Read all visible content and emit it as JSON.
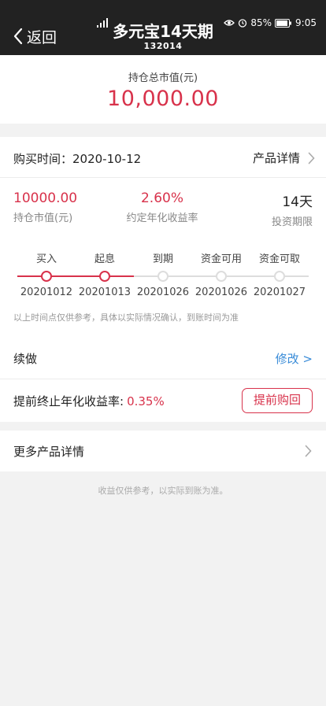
{
  "header": {
    "back_label": "返回",
    "title": "多元宝14天期",
    "code": "132014",
    "status": {
      "battery": "85%",
      "time": "9:05"
    }
  },
  "summary": {
    "label": "持仓总市值(元)",
    "value": "10,000.00"
  },
  "purchase": {
    "label": "购买时间：2020-10-12",
    "detail_link": "产品详情"
  },
  "stats": [
    {
      "value": "10000.00",
      "label": "持仓市值(元)"
    },
    {
      "value": "2.60%",
      "label": "约定年化收益率"
    },
    {
      "value": "14天",
      "label": "投资期限"
    }
  ],
  "timeline": {
    "steps": [
      {
        "label": "买入",
        "date": "20201012",
        "active": true
      },
      {
        "label": "起息",
        "date": "20201013",
        "active": true
      },
      {
        "label": "到期",
        "date": "20201026",
        "active": false
      },
      {
        "label": "资金可用",
        "date": "20201026",
        "active": false
      },
      {
        "label": "资金可取",
        "date": "20201027",
        "active": false
      }
    ],
    "note": "以上时间点仅供参考，具体以实际情况确认，到账时间为准"
  },
  "renew": {
    "label": "续做",
    "action": "修改 >"
  },
  "early_termination": {
    "label": "提前终止年化收益率:",
    "rate": "0.35%",
    "button": "提前购回"
  },
  "more": {
    "label": "更多产品详情"
  },
  "footer_note": "收益仅供参考，以实际到账为准。",
  "colors": {
    "accent": "#d8324b",
    "link": "#3a8cd8",
    "header_bg": "#222222",
    "inactive": "#dddddd"
  }
}
